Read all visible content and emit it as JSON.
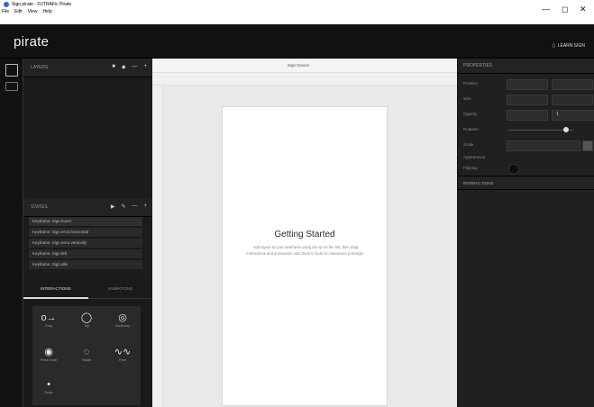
{
  "window": {
    "title": "Sign.pirate - FUTRAFic Pirate",
    "menu": [
      "File",
      "Edit",
      "View",
      "Help"
    ],
    "controls": {
      "minimize": "—",
      "maximize": "◻",
      "close": "✕"
    }
  },
  "app": {
    "logo": "pirate",
    "account": "LEARN SIGN"
  },
  "layers_panel": {
    "label": "LAYERS",
    "controls": [
      "■",
      "◆",
      "—",
      "+"
    ]
  },
  "states_panel": {
    "label": "STATES",
    "controls": [
      "▶",
      "✎",
      "—",
      "+"
    ],
    "items": [
      "Keyframe: Sign.hover",
      "Keyframe: Sign.error.horizontal",
      "Keyframe: Sign.error.vertically",
      "Keyframe: Sign.left",
      "Keyframe: Sign.idle"
    ]
  },
  "interactions_panel": {
    "tabs": [
      "INTERACTIONS",
      "ANIMATIONS"
    ],
    "items": [
      {
        "icon": "o→",
        "label": "Drag"
      },
      {
        "icon": "◯",
        "label": "Tap"
      },
      {
        "icon": "◎",
        "label": "Doubletap"
      },
      {
        "icon": "◉",
        "label": "Press Down"
      },
      {
        "icon": "◌",
        "label": "Rotate"
      },
      {
        "icon": "∿∿",
        "label": "Pinch"
      },
      {
        "icon": "•",
        "label": "Swipe"
      }
    ]
  },
  "canvas": {
    "title": "Sign  Device",
    "getting_started_title": "Getting Started",
    "getting_started_body": "Add layers to your wireframe using the tip on the left, then drag interactions and animations onto them to build an interactive prototype."
  },
  "properties": {
    "label": "PROPERTIES",
    "rows": [
      "Position",
      "Size",
      "Opacity",
      "Rotation",
      "Scale",
      "Appearance",
      "Flipping"
    ],
    "opacity_value": "1",
    "knob_level": 0.89
  },
  "interactions_header": {
    "label": "INTERACTIONS"
  }
}
